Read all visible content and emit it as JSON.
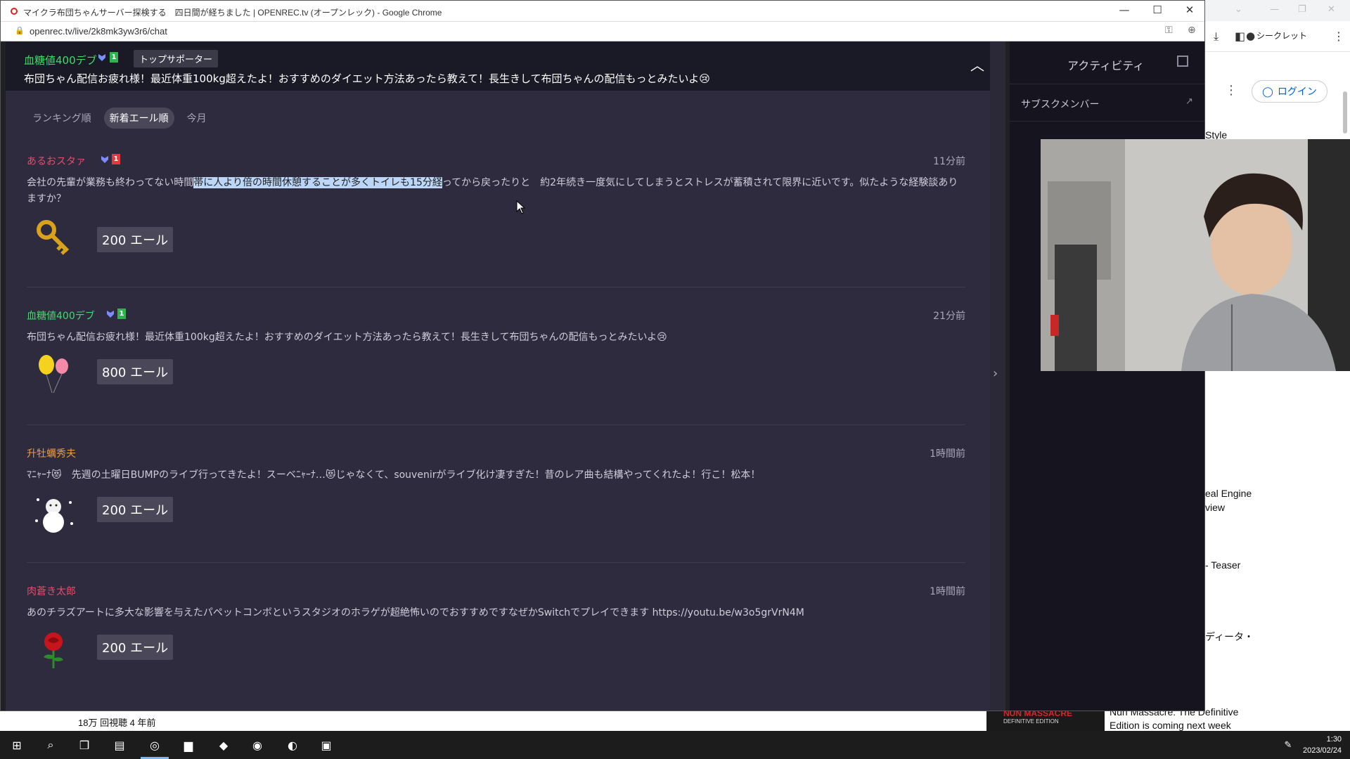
{
  "browser": {
    "title": "マイクラ布団ちゃんサーバー探検する　四日間が経ちました | OPENREC.tv (オープンレック) - Google Chrome",
    "url": "openrec.tv/live/2k8mk3yw3r6/chat"
  },
  "back_window": {
    "incognito_label": "シークレット",
    "login_label": "ログイン",
    "snippets": [
      "Style",
      "eal Engine",
      "view",
      "- Teaser",
      "ディータ・"
    ],
    "views": "18万 回視聴  4 年前",
    "thumb_title": "NUN MASSACRE",
    "thumb_subtitle": "DEFINITIVE EDITION",
    "next_title": "Nun Massacre: The Definitive Edition is coming next week"
  },
  "pinned": {
    "name": "血糖値400デブ",
    "rank": "1",
    "supporter_label": "トップサポーター",
    "message": "布団ちゃん配信お疲れ様！最近体重100kg超えたよ！おすすめのダイエット方法あったら教えて！長生きして布団ちゃんの配信もっとみたいよ😢"
  },
  "tabs": [
    {
      "label": "ランキング順",
      "active": false
    },
    {
      "label": "新着エール順",
      "active": true
    },
    {
      "label": "今月",
      "active": false
    }
  ],
  "posts": [
    {
      "name": "あるおスタァ",
      "name_color": "#e34f6b",
      "rank": "1",
      "rank_color": "#e5383b",
      "time": "11分前",
      "text_before": "会社の先輩が業務も終わってない時間",
      "text_highlight": "帯に人より倍の時間休憩することが多くトイレも15分経",
      "text_after": "ってから戻ったりと　約2年続き一度気にしてしまうとストレスが蓄積されて限界に近いです。似たような経験談ありますか？",
      "gift": "key-icon",
      "yell": "200 エール"
    },
    {
      "name": "血糖値400デブ",
      "name_color": "#3fdc6c",
      "rank": "1",
      "rank_color": "#2fb34f",
      "time": "21分前",
      "text_before": "布団ちゃん配信お疲れ様！最近体重100kg超えたよ！おすすめのダイエット方法あったら教えて！長生きして布団ちゃんの配信もっとみたいよ😢",
      "text_highlight": "",
      "text_after": "",
      "gift": "balloons-icon",
      "yell": "800 エール"
    },
    {
      "name": "升牡蠣秀夫",
      "name_color": "#f09a3e",
      "rank": "",
      "rank_color": "",
      "time": "1時間前",
      "text_before": "ﾏﾆｬｰﾅ😻　先週の土曜日BUMPのライブ行ってきたよ！スーベﾆｬｰﾅ…😻じゃなくて、souvenirがライブ化け凄すぎた！昔のレア曲も結構やってくれたよ！行こ！松本！",
      "text_highlight": "",
      "text_after": "",
      "gift": "snowman-icon",
      "yell": "200 エール"
    },
    {
      "name": "肉蒼き太郎",
      "name_color": "#e34f6b",
      "rank": "",
      "rank_color": "",
      "time": "1時間前",
      "text_before": "あのチラズアートに多大な影響を与えたパペットコンボというスタジオのホラゲが超絶怖いのでおすすめですなぜかSwitchでプレイできます https://youtu.be/w3o5grVrN4M",
      "text_highlight": "",
      "text_after": "",
      "gift": "rose-icon",
      "yell": "200 エール"
    }
  ],
  "activity": {
    "title": "アクティビティ",
    "subscribe_label": "サブスクメンバー"
  },
  "taskbar": {
    "time": "1:30",
    "date": "2023/02/24"
  }
}
